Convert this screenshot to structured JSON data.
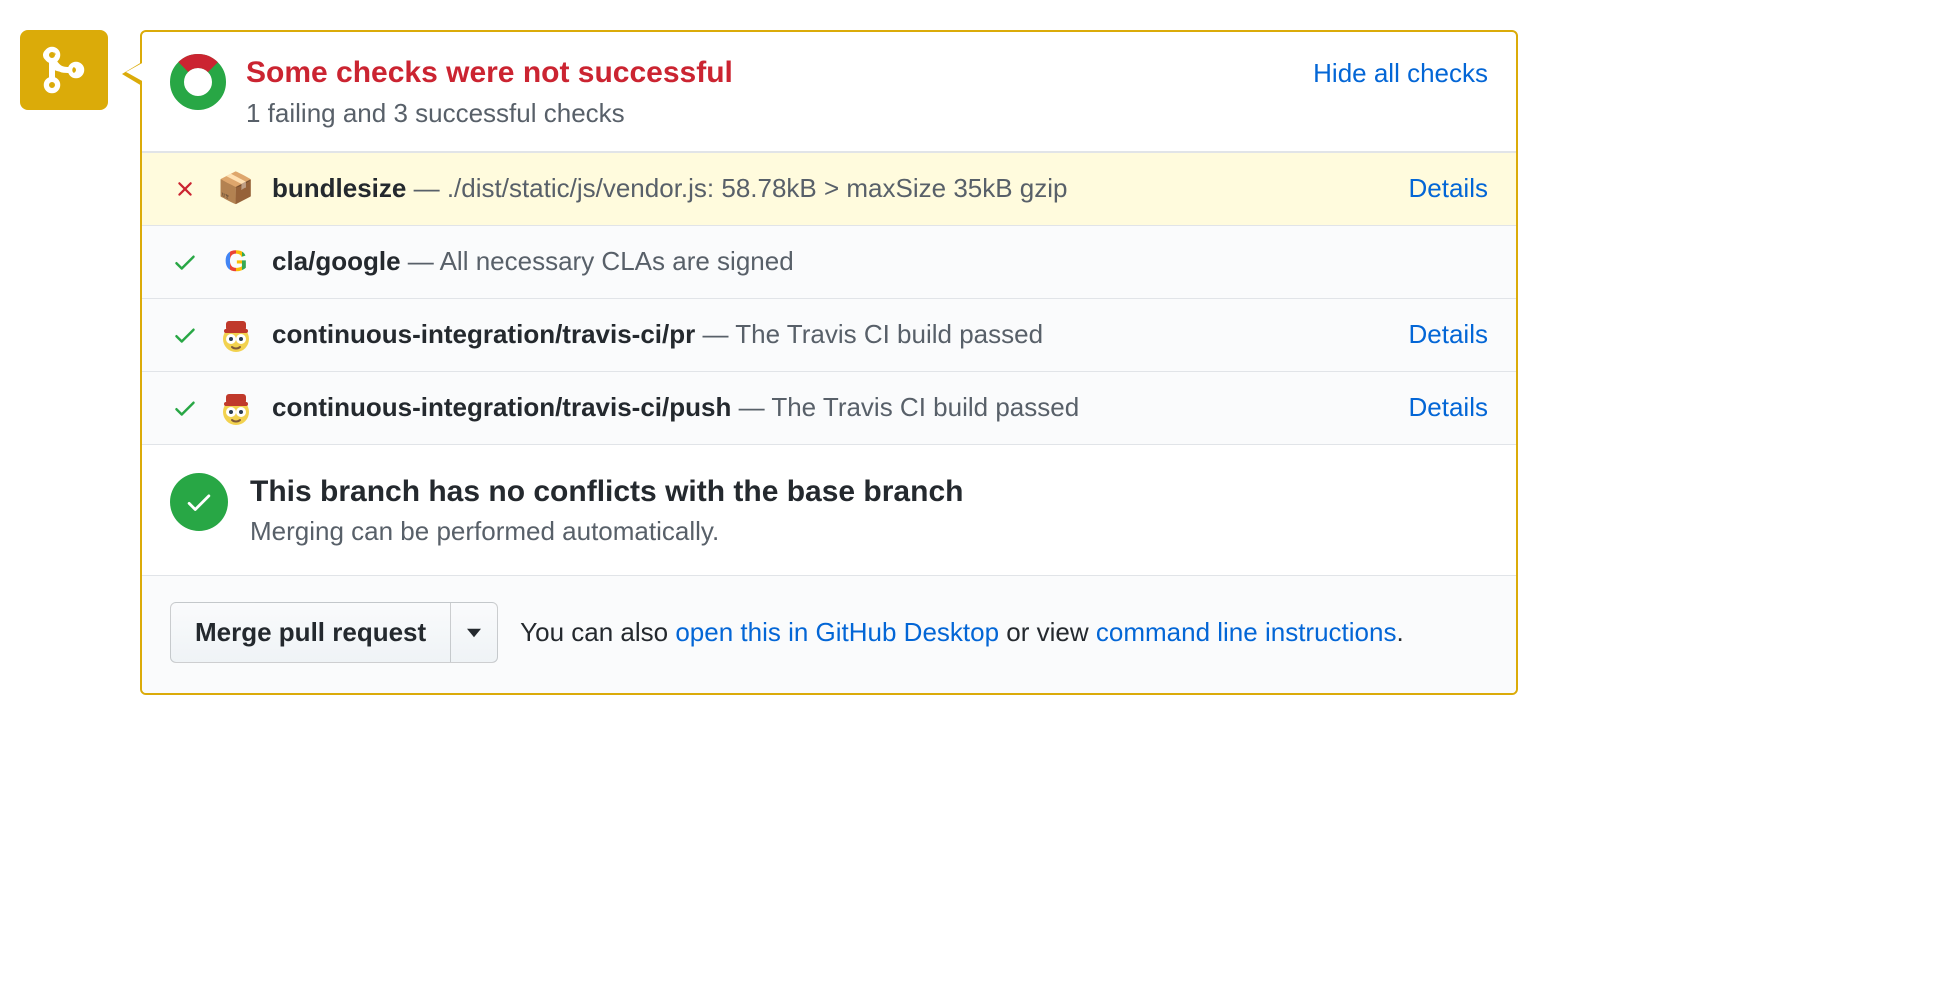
{
  "timeline": {
    "badge_color": "#dbab09"
  },
  "summary": {
    "title": "Some checks were not successful",
    "subtitle": "1 failing and 3 successful checks",
    "toggle_label": "Hide all checks"
  },
  "checks": [
    {
      "status": "fail",
      "avatar": "📦",
      "avatar_name": "bundlesize-icon",
      "name": "bundlesize",
      "description": "./dist/static/js/vendor.js: 58.78kB > maxSize 35kB gzip",
      "details": "Details"
    },
    {
      "status": "pass",
      "avatar": "G",
      "avatar_name": "google-icon",
      "name": "cla/google",
      "description": "All necessary CLAs are signed",
      "details": ""
    },
    {
      "status": "pass",
      "avatar": "travis",
      "avatar_name": "travis-icon",
      "name": "continuous-integration/travis-ci/pr",
      "description": "The Travis CI build passed",
      "details": "Details"
    },
    {
      "status": "pass",
      "avatar": "travis",
      "avatar_name": "travis-icon",
      "name": "continuous-integration/travis-ci/push",
      "description": "The Travis CI build passed",
      "details": "Details"
    }
  ],
  "mergeability": {
    "title": "This branch has no conflicts with the base branch",
    "subtitle": "Merging can be performed automatically."
  },
  "actions": {
    "merge_button": "Merge pull request",
    "hint_prefix": "You can also ",
    "hint_link1": "open this in GitHub Desktop",
    "hint_mid": " or view ",
    "hint_link2": "command line instructions",
    "hint_suffix": "."
  }
}
